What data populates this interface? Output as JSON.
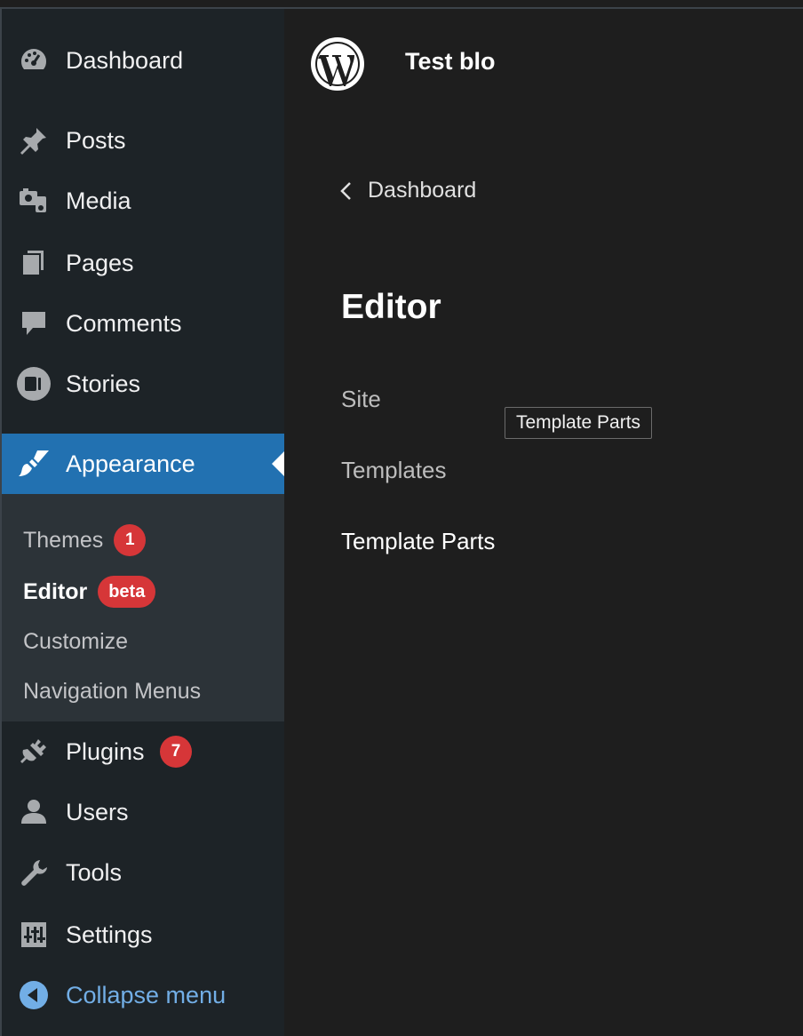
{
  "sidebar": {
    "items": [
      {
        "label": "Dashboard",
        "icon": "dashboard-icon"
      },
      {
        "label": "Posts",
        "icon": "pin-icon"
      },
      {
        "label": "Media",
        "icon": "media-icon"
      },
      {
        "label": "Pages",
        "icon": "pages-icon"
      },
      {
        "label": "Comments",
        "icon": "comment-icon"
      },
      {
        "label": "Stories",
        "icon": "stories-icon"
      },
      {
        "label": "Appearance",
        "icon": "paintbrush-icon"
      },
      {
        "label": "Plugins",
        "icon": "plug-icon",
        "badge": "7"
      },
      {
        "label": "Users",
        "icon": "user-icon"
      },
      {
        "label": "Tools",
        "icon": "wrench-icon"
      },
      {
        "label": "Settings",
        "icon": "settings-sliders-icon"
      },
      {
        "label": "Collapse menu",
        "icon": "collapse-arrow-icon"
      }
    ],
    "appearance_submenu": [
      {
        "label": "Themes",
        "badge": "1"
      },
      {
        "label": "Editor",
        "badge": "beta"
      },
      {
        "label": "Customize"
      },
      {
        "label": "Navigation Menus"
      }
    ]
  },
  "header": {
    "site_title": "Test blo"
  },
  "main": {
    "back_label": "Dashboard",
    "title": "Editor",
    "links": [
      "Site",
      "Templates",
      "Template Parts"
    ],
    "tooltip": "Template Parts"
  },
  "colors": {
    "sidebar_bg": "#1d2327",
    "submenu_bg": "#2c3338",
    "active_bg": "#2271b1",
    "badge_red": "#d63638",
    "collapse_blue": "#72aee6",
    "main_bg": "#1e1e1e"
  }
}
